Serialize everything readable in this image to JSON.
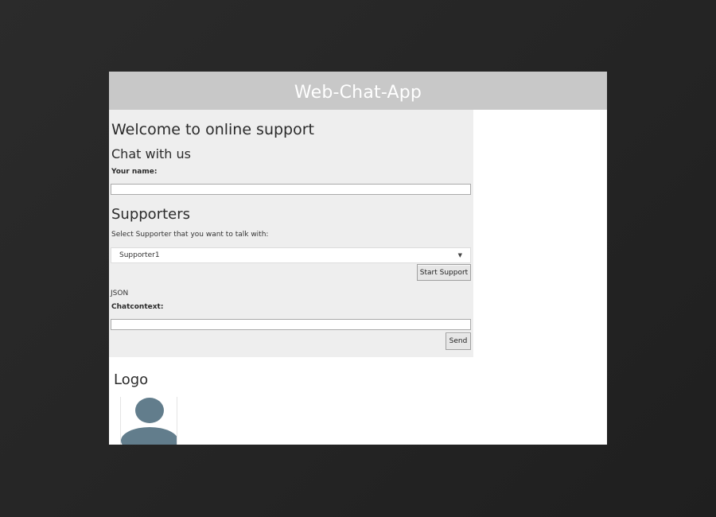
{
  "app": {
    "title": "Web-Chat-App"
  },
  "chat": {
    "welcome_title": "Welcome to online support",
    "subtitle": "Chat with us",
    "name_label": "Your name:",
    "name_value": "",
    "supporters_title": "Supporters",
    "select_prompt": "Select Supporter that you want to talk with:",
    "supporter_selected": "Supporter1",
    "start_button": "Start Support",
    "json_label": "JSON",
    "context_label": "Chatcontext:",
    "context_value": "",
    "send_button": "Send"
  },
  "logo": {
    "title": "Logo",
    "icon": "user-avatar-icon"
  },
  "colors": {
    "header_bg": "#c8c8c8",
    "panel_bg": "#eeeeee",
    "avatar": "#627d8c",
    "backdrop": "#252525"
  }
}
